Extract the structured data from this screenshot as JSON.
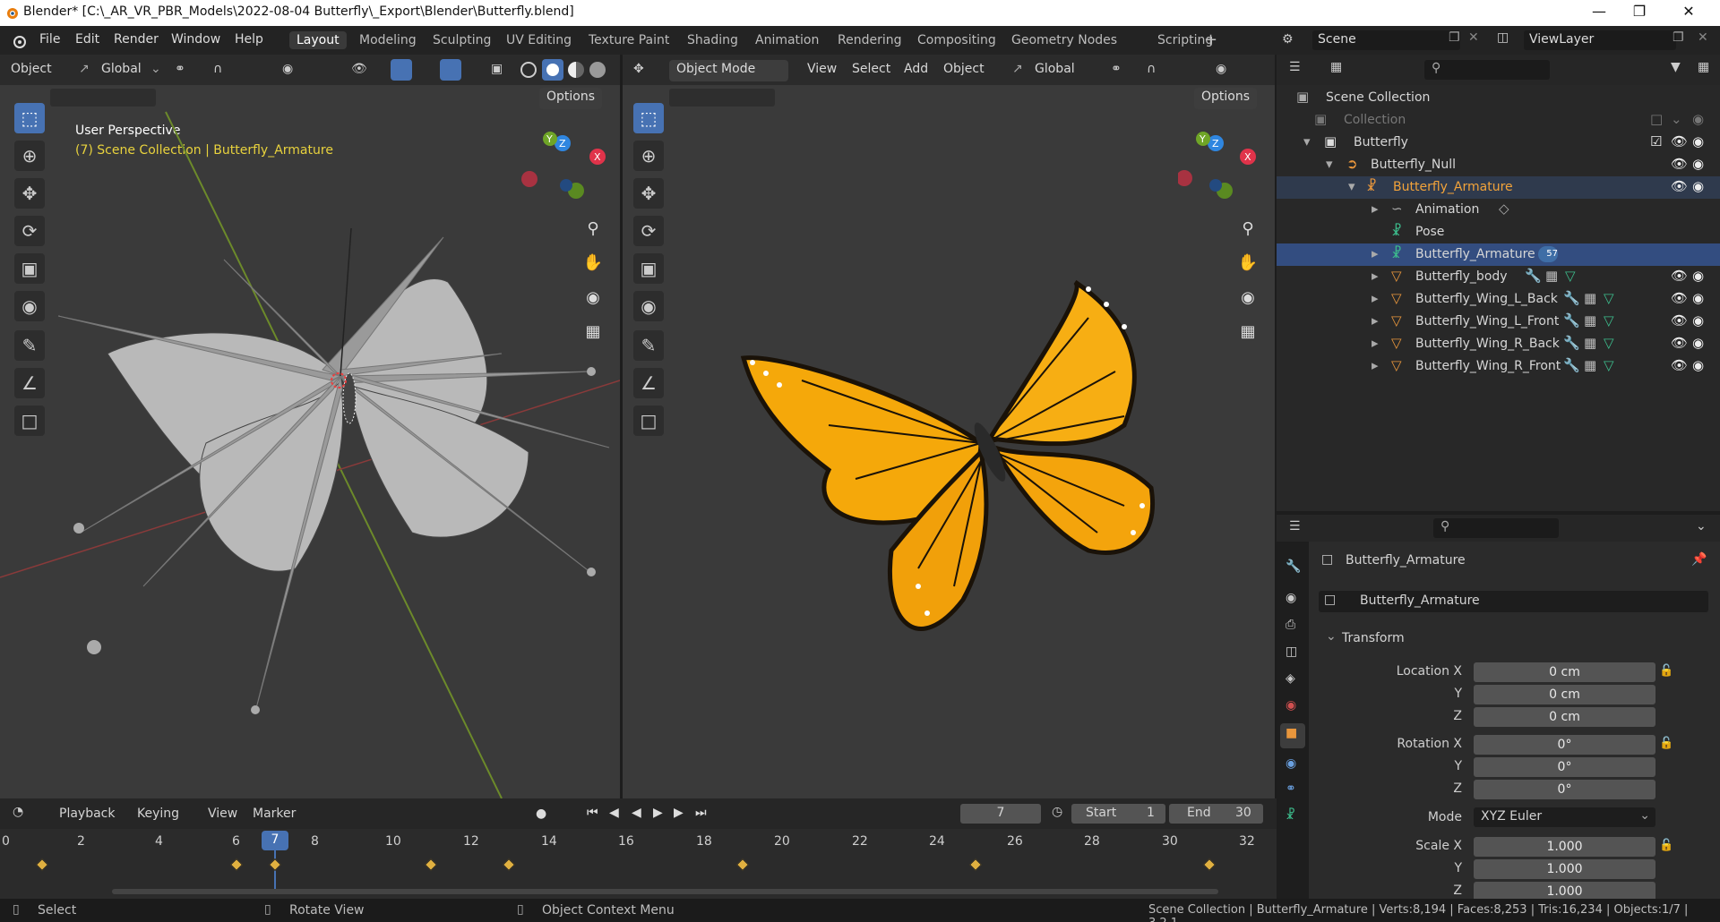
{
  "title": "Blender* [C:\\_AR_VR_PBR_Models\\2022-08-04 Butterfly\\_Export\\Blender\\Butterfly.blend]",
  "menu": [
    "File",
    "Edit",
    "Render",
    "Window",
    "Help"
  ],
  "workspaces": [
    "Layout",
    "Modeling",
    "Sculpting",
    "UV Editing",
    "Texture Paint",
    "Shading",
    "Animation",
    "Rendering",
    "Compositing",
    "Geometry Nodes",
    "Scripting"
  ],
  "scene": {
    "name": "Scene",
    "viewlayer": "ViewLayer"
  },
  "left_viewport": {
    "mode": "Object",
    "orientation": "Global",
    "options": "Options",
    "title": "User Perspective",
    "subtitle": "(7) Scene Collection | Butterfly_Armature"
  },
  "right_viewport": {
    "mode": "Object Mode",
    "menus": [
      "View",
      "Select",
      "Add",
      "Object"
    ],
    "orientation": "Global",
    "options": "Options"
  },
  "outliner": {
    "rows": [
      {
        "label": "Scene Collection"
      },
      {
        "label": "Collection"
      },
      {
        "label": "Butterfly"
      },
      {
        "label": "Butterfly_Null"
      },
      {
        "label": "Butterfly_Armature"
      },
      {
        "label": "Animation"
      },
      {
        "label": "Pose"
      },
      {
        "label": "Butterfly_Armature",
        "badge": "57"
      },
      {
        "label": "Butterfly_body"
      },
      {
        "label": "Butterfly_Wing_L_Back"
      },
      {
        "label": "Butterfly_Wing_L_Front"
      },
      {
        "label": "Butterfly_Wing_R_Back"
      },
      {
        "label": "Butterfly_Wing_R_Front"
      }
    ]
  },
  "properties": {
    "object_name": "Butterfly_Armature",
    "data_name": "Butterfly_Armature",
    "panel": "Transform",
    "location_label": "Location X",
    "rotation_label": "Rotation X",
    "scale_label": "Scale X",
    "y_label": "Y",
    "z_label": "Z",
    "mode_label": "Mode",
    "location": [
      "0 cm",
      "0 cm",
      "0 cm"
    ],
    "rotation": [
      "0°",
      "0°",
      "0°"
    ],
    "mode": "XYZ Euler",
    "scale": [
      "1.000",
      "1.000",
      "1.000"
    ]
  },
  "timeline": {
    "menus": [
      "Playback",
      "Keying",
      "View",
      "Marker"
    ],
    "current_frame": "7",
    "start_label": "Start",
    "start": "1",
    "end_label": "End",
    "end": "30",
    "ticks": [
      "0",
      "2",
      "4",
      "6",
      "7",
      "8",
      "10",
      "12",
      "14",
      "16",
      "18",
      "20",
      "22",
      "24",
      "26",
      "28",
      "30",
      "32"
    ]
  },
  "status": {
    "select": "Select",
    "rotate": "Rotate View",
    "context": "Object Context Menu",
    "info": "Scene Collection | Butterfly_Armature | Verts:8,194 | Faces:8,253 | Tris:16,234 | Objects:1/7 | 3.2.1"
  },
  "colors": {
    "accent": "#4772b3",
    "selection": "#334d80",
    "keyframe": "#e0b040",
    "wing": "#f5a80a"
  }
}
